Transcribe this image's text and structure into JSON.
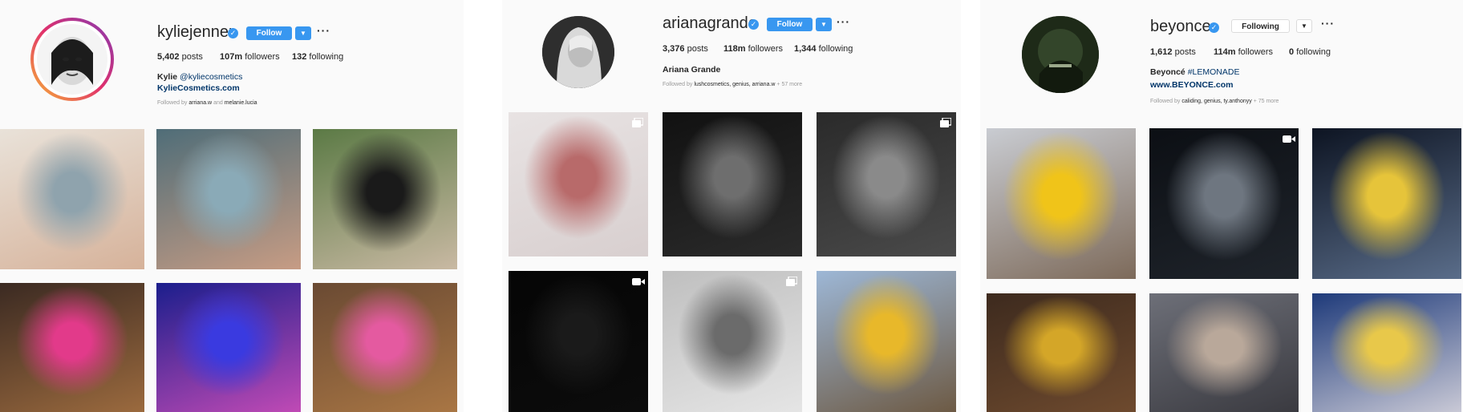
{
  "profiles": [
    {
      "username": "kyliejenner",
      "button": "Follow",
      "stats": {
        "posts": "5,402",
        "posts_label": "posts",
        "followers": "107m",
        "followers_label": "followers",
        "following": "132",
        "following_label": "following"
      },
      "bio_name": "Kylie",
      "bio_handle": "@kyliecosmetics",
      "bio_url": "KylieCosmetics.com",
      "followed_prefix": "Followed by",
      "followed_names": "arriana.w",
      "followed_and": "and",
      "followed_more": "melanie.lucia",
      "tiles": [
        {
          "name": "kylie-post-1",
          "colors": [
            "#e9e2d9",
            "#8fa3ad",
            "#d6b29a"
          ]
        },
        {
          "name": "kylie-post-2",
          "colors": [
            "#4f6d78",
            "#8aaab7",
            "#c79c84"
          ]
        },
        {
          "name": "kylie-post-3",
          "colors": [
            "#5b7a45",
            "#1a1a1a",
            "#c9b9a3"
          ]
        },
        {
          "name": "kylie-post-4",
          "colors": [
            "#3b2a22",
            "#e23a8a",
            "#9b6a3e"
          ]
        },
        {
          "name": "kylie-post-5",
          "colors": [
            "#1b1e8c",
            "#3a3ae0",
            "#c04ab5"
          ]
        },
        {
          "name": "kylie-post-6",
          "colors": [
            "#6a4a33",
            "#e45aa0",
            "#a97644"
          ]
        }
      ]
    },
    {
      "username": "arianagrande",
      "button": "Follow",
      "stats": {
        "posts": "3,376",
        "posts_label": "posts",
        "followers": "118m",
        "followers_label": "followers",
        "following": "1,344",
        "following_label": "following"
      },
      "bio_name": "Ariana Grande",
      "followed_prefix": "Followed by",
      "followed_names": "lushcosmetics, genius, arriana.w",
      "followed_more": "+ 57 more",
      "tiles": [
        {
          "name": "ariana-post-1",
          "colors": [
            "#e8e3e3",
            "#b86a6a",
            "#d8cfcf"
          ],
          "icon": "multi"
        },
        {
          "name": "ariana-post-2",
          "colors": [
            "#111111",
            "#6e6e6e",
            "#2b2b2b"
          ]
        },
        {
          "name": "ariana-post-3",
          "colors": [
            "#2a2a2a",
            "#8a8a8a",
            "#4a4a4a"
          ],
          "icon": "multi"
        },
        {
          "name": "ariana-post-4",
          "colors": [
            "#050505",
            "#1a1a1a",
            "#0c0c0c"
          ],
          "icon": "video"
        },
        {
          "name": "ariana-post-5",
          "colors": [
            "#bfbfbf",
            "#6b6b6b",
            "#e5e5e5"
          ],
          "icon": "multi"
        },
        {
          "name": "ariana-post-6",
          "colors": [
            "#9db7d6",
            "#e8b82a",
            "#6d5a44"
          ]
        }
      ]
    },
    {
      "username": "beyonce",
      "button": "Following",
      "stats": {
        "posts": "1,612",
        "posts_label": "posts",
        "followers": "114m",
        "followers_label": "followers",
        "following": "0",
        "following_label": "following"
      },
      "bio_name": "Beyoncé",
      "bio_handle": "#LEMONADE",
      "bio_url": "www.BEYONCE.com",
      "followed_prefix": "Followed by",
      "followed_names": "caliding, genius, ty.anthonyy",
      "followed_more": "+ 75 more",
      "tiles": [
        {
          "name": "beyonce-post-1",
          "colors": [
            "#c9ccd2",
            "#f0c419",
            "#7d6a5a"
          ]
        },
        {
          "name": "beyonce-post-2",
          "colors": [
            "#0c0f14",
            "#6e7680",
            "#1f242b"
          ],
          "icon": "video"
        },
        {
          "name": "beyonce-post-3",
          "colors": [
            "#0d1422",
            "#e6c43a",
            "#5a6d8a"
          ]
        },
        {
          "name": "beyonce-post-4",
          "colors": [
            "#3d2a1e",
            "#d4a628",
            "#6e4a2e"
          ]
        },
        {
          "name": "beyonce-post-5",
          "colors": [
            "#6d6f78",
            "#b9a89a",
            "#3a3a40"
          ]
        },
        {
          "name": "beyonce-post-6",
          "colors": [
            "#1e3a7a",
            "#e8c84a",
            "#c9c9d6"
          ]
        }
      ]
    }
  ]
}
